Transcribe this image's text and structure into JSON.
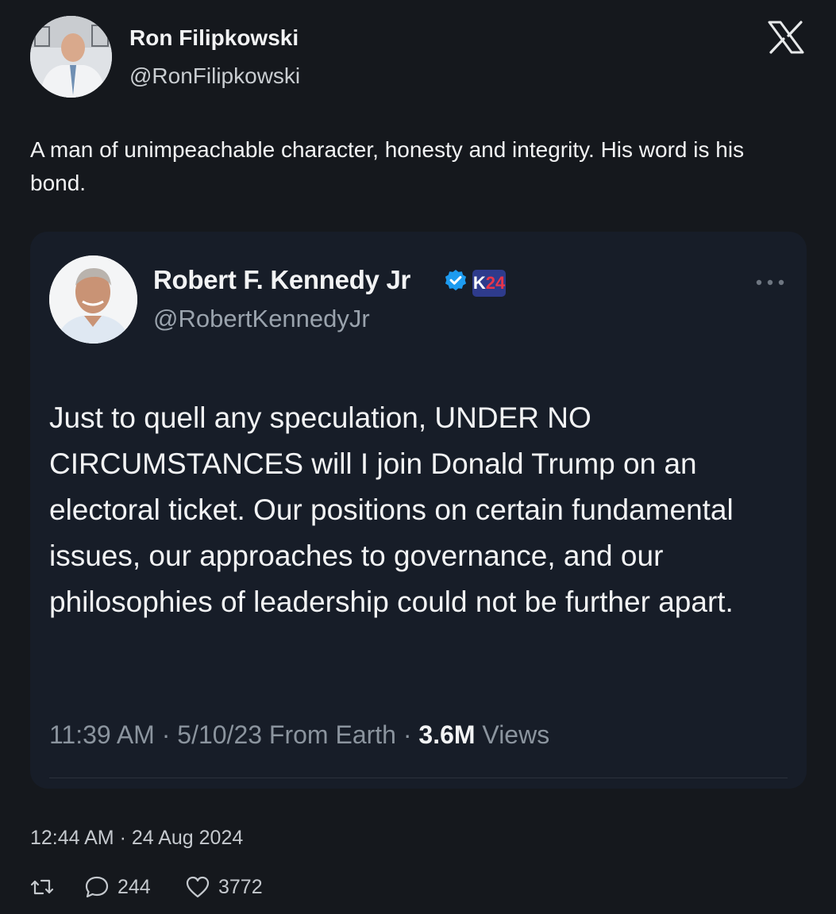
{
  "outer_tweet": {
    "author_name": "Ron Filipkowski",
    "author_handle": "@RonFilipkowski",
    "text": "A man of unimpeachable character, honesty and integrity. His word is his bond.",
    "timestamp": "12:44 AM · 24 Aug 2024",
    "replies": "244",
    "likes": "3772",
    "brand_icon": "x-logo-icon"
  },
  "quoted_tweet": {
    "author_name": "Robert F. Kennedy Jr",
    "author_handle": "@RobertKennedyJr",
    "badge_text_k": "K",
    "badge_text_num": "24",
    "text": "Just to quell any speculation, UNDER NO CIRCUMSTANCES will I join Donald Trump on an electoral ticket. Our positions on certain fundamental issues, our approaches to governance, and our philosophies of leadership could not be further apart.",
    "time": "11:39 AM",
    "date_source": "5/10/23 From Earth",
    "views_count": "3.6M",
    "views_label": "Views"
  },
  "colors": {
    "background": "#15181d",
    "card": "#171d28",
    "verified_blue": "#1d9bf0",
    "badge_bg": "#2e3b8c",
    "badge_red": "#e8354a"
  }
}
